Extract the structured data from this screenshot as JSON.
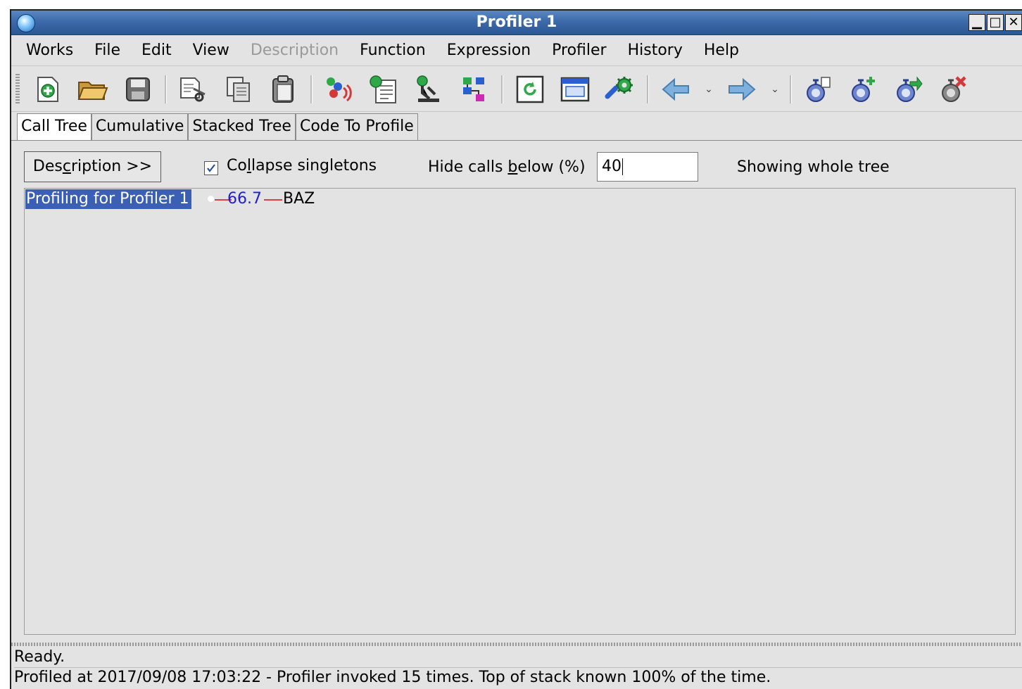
{
  "window": {
    "title": "Profiler 1",
    "controls": [
      "minimize",
      "maximize",
      "close"
    ]
  },
  "menu": [
    {
      "label": "Works",
      "enabled": true
    },
    {
      "label": "File",
      "enabled": true
    },
    {
      "label": "Edit",
      "enabled": true
    },
    {
      "label": "View",
      "enabled": true
    },
    {
      "label": "Description",
      "enabled": false
    },
    {
      "label": "Function",
      "enabled": true
    },
    {
      "label": "Expression",
      "enabled": true
    },
    {
      "label": "Profiler",
      "enabled": true
    },
    {
      "label": "History",
      "enabled": true
    },
    {
      "label": "Help",
      "enabled": true
    }
  ],
  "toolbar_icons": [
    "new-icon",
    "open-folder-icon",
    "save-icon",
    "cut-icon",
    "copy-icon",
    "paste-icon",
    "run-function-icon",
    "function-list-icon",
    "inspect-icon",
    "tree-icon",
    "refresh-icon",
    "window-icon",
    "settings-gear-icon",
    "back-arrow-icon",
    "forward-arrow-icon",
    "profiler-new-icon",
    "profiler-add-icon",
    "profiler-export-icon",
    "profiler-delete-icon"
  ],
  "tabs": [
    {
      "label": "Call Tree",
      "active": true
    },
    {
      "label": "Cumulative",
      "active": false
    },
    {
      "label": "Stacked Tree",
      "active": false
    },
    {
      "label": "Code To Profile",
      "active": false
    }
  ],
  "controls": {
    "description_button": {
      "pre": "Des",
      "mnemonic": "c",
      "post": "ription >>"
    },
    "collapse_singletons": {
      "pre": "Co",
      "mnemonic": "l",
      "post": "lapse singletons",
      "checked": true
    },
    "hide_calls": {
      "pre": "Hide calls ",
      "mnemonic": "b",
      "post": "elow (%)"
    },
    "threshold_value": "40",
    "showing_text": "Showing whole tree"
  },
  "tree": {
    "root_label": "Profiling for Profiler 1",
    "edge_percent": "66.7",
    "child_label": "BAZ"
  },
  "status": {
    "ready": "Ready.",
    "info": "Profiled at 2017/09/08 17:03:22 - Profiler invoked 15 times. Top of stack known 100% of the time."
  },
  "colors": {
    "titlebar": "#3d6aaa",
    "selection": "#3a5fb5",
    "edge_line": "#d8434a",
    "edge_percent": "#2020d0"
  }
}
